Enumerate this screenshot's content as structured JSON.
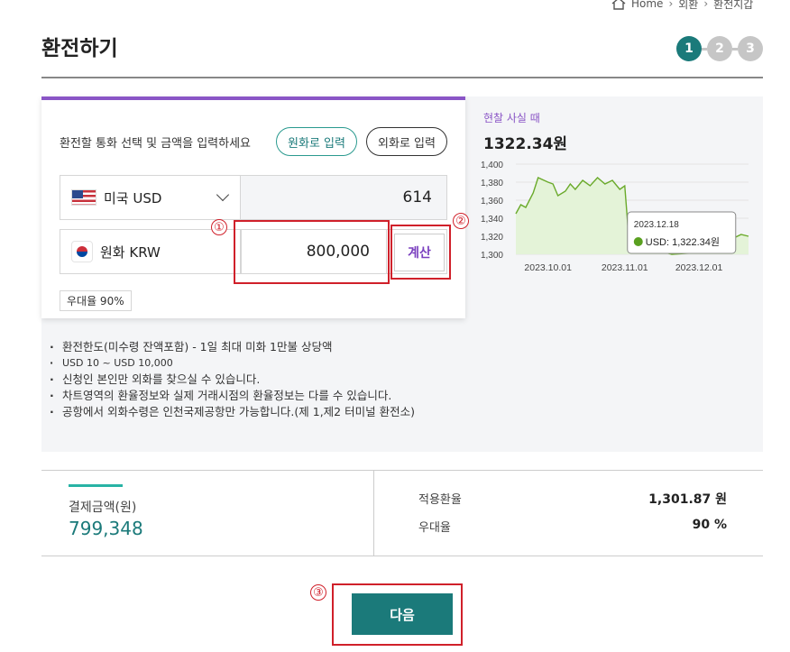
{
  "breadcrumb": {
    "home": "Home",
    "level2": "외환",
    "level3": "환전지갑"
  },
  "page_title": "환전하기",
  "steps": [
    "1",
    "2",
    "3"
  ],
  "form": {
    "instruction": "환전할 통화 선택 및 금액을 입력하세요",
    "krw_input_button": "원화로 입력",
    "foreign_input_button": "외화로 입력",
    "foreign_currency": "미국 USD",
    "foreign_amount": "614",
    "krw_currency": "원화 KRW",
    "krw_amount": "800,000",
    "calc_button": "계산",
    "discount_badge": "우대율 90%"
  },
  "annotations": [
    "①",
    "②",
    "③"
  ],
  "chart_panel": {
    "caption": "현찰 사실 때",
    "rate": "1322.34원",
    "tooltip_date": "2023.12.18",
    "tooltip_value": "USD: 1,322.34원"
  },
  "chart_data": {
    "type": "area",
    "x": [
      "2023.09.18",
      "2023.09.20",
      "2023.09.22",
      "2023.09.25",
      "2023.09.27",
      "2023.10.01",
      "2023.10.03",
      "2023.10.05",
      "2023.10.08",
      "2023.10.10",
      "2023.10.12",
      "2023.10.15",
      "2023.10.18",
      "2023.10.21",
      "2023.10.24",
      "2023.10.27",
      "2023.10.30",
      "2023.11.01",
      "2023.11.03",
      "2023.11.10",
      "2023.11.20",
      "2023.12.01",
      "2023.12.10",
      "2023.12.15",
      "2023.12.18",
      "2023.12.21"
    ],
    "values": [
      1345,
      1355,
      1352,
      1368,
      1385,
      1380,
      1378,
      1365,
      1370,
      1378,
      1372,
      1382,
      1376,
      1385,
      1378,
      1382,
      1372,
      1376,
      1305,
      1308,
      1300,
      1302,
      1306,
      1318,
      1322,
      1320
    ],
    "xticks": [
      "2023.10.01",
      "2023.11.01",
      "2023.12.01"
    ],
    "yticks": [
      "1,400",
      "1,380",
      "1,360",
      "1,340",
      "1,320",
      "1,300"
    ],
    "ylim": [
      1300,
      1400
    ],
    "line_color": "#6aaa2a",
    "fill_color": "#e4f3d8"
  },
  "notes": [
    "환전한도(미수령 잔액포함) - 1일 최대 미화 1만불 상당액",
    "USD 10 ~ USD 10,000",
    "신청인 본인만 외화를 찾으실 수 있습니다.",
    "차트영역의 환율정보와 실제 거래시점의 환율정보는 다를 수 있습니다.",
    "공항에서 외화수령은 인천국제공항만 가능합니다.(제 1,제2 터미널 환전소)"
  ],
  "summary": {
    "payment_label": "결제금액(원)",
    "payment_amount": "799,348",
    "applied_rate_label": "적용환율",
    "applied_rate_value": "1,301.87 원",
    "discount_label": "우대율",
    "discount_value": "90 %"
  },
  "next_button": "다음",
  "colors": {
    "accent": "#1b7a7a",
    "purple": "#8a55c6",
    "annotation": "#d0202a"
  }
}
